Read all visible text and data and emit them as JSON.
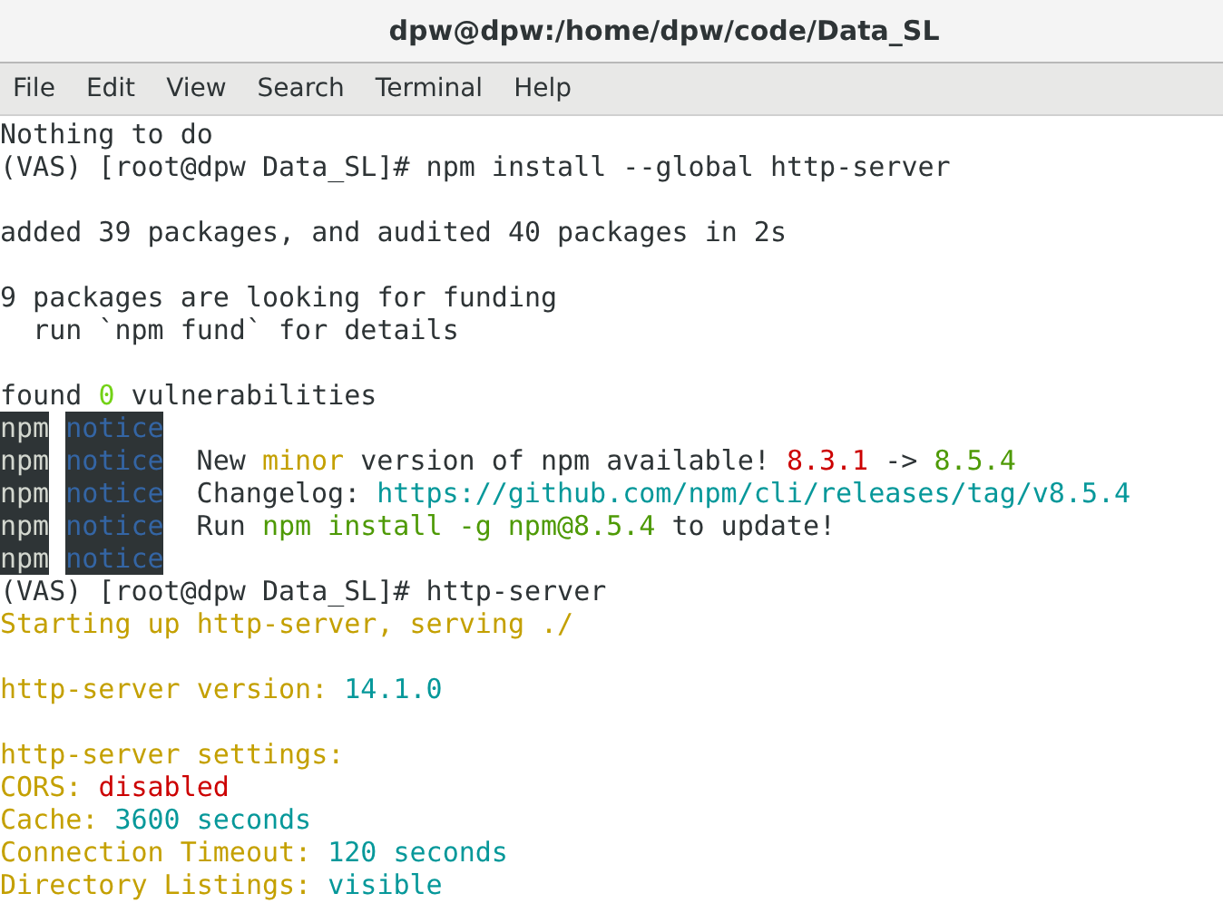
{
  "window": {
    "title": "dpw@dpw:/home/dpw/code/Data_SL"
  },
  "menu": [
    {
      "label": "File"
    },
    {
      "label": "Edit"
    },
    {
      "label": "View"
    },
    {
      "label": "Search"
    },
    {
      "label": "Terminal"
    },
    {
      "label": "Help"
    }
  ],
  "terminal": {
    "lines": [
      {
        "kind": "output",
        "segments": [
          {
            "kind": "text",
            "text": "Nothing to do",
            "color": "#2e3436"
          }
        ]
      },
      {
        "kind": "output",
        "segments": [
          {
            "kind": "text",
            "text": "(VAS) [root@dpw Data_SL]# npm install --global http-server",
            "color": "#2e3436"
          }
        ]
      },
      {
        "kind": "blank"
      },
      {
        "kind": "output",
        "segments": [
          {
            "kind": "text",
            "text": "added 39 packages, and audited 40 packages in 2s",
            "color": "#2e3436"
          }
        ]
      },
      {
        "kind": "blank"
      },
      {
        "kind": "output",
        "segments": [
          {
            "kind": "text",
            "text": "9 packages are looking for funding",
            "color": "#2e3436"
          }
        ]
      },
      {
        "kind": "output",
        "segments": [
          {
            "kind": "text",
            "text": "  run `npm fund` for details",
            "color": "#2e3436"
          }
        ]
      },
      {
        "kind": "blank"
      },
      {
        "kind": "output",
        "segments": [
          {
            "kind": "text",
            "text": "found ",
            "color": "#2e3436"
          },
          {
            "kind": "text",
            "text": "0",
            "color": "#73d216"
          },
          {
            "kind": "text",
            "text": " vulnerabilities",
            "color": "#2e3436"
          }
        ]
      },
      {
        "kind": "output",
        "segments": [
          {
            "kind": "source-tag",
            "text": "npm"
          },
          {
            "kind": "level-tag",
            "text": "notice"
          }
        ]
      },
      {
        "kind": "output",
        "segments": [
          {
            "kind": "source-tag",
            "text": "npm"
          },
          {
            "kind": "level-tag",
            "text": "notice"
          },
          {
            "kind": "text",
            "text": " New ",
            "color": "#2e3436"
          },
          {
            "kind": "text",
            "text": "minor",
            "color": "#c4a000"
          },
          {
            "kind": "text",
            "text": " version of npm available! ",
            "color": "#2e3436"
          },
          {
            "kind": "text",
            "text": "8.3.1",
            "color": "#cc0000"
          },
          {
            "kind": "text",
            "text": " -> ",
            "color": "#2e3436"
          },
          {
            "kind": "text",
            "text": "8.5.4",
            "color": "#4e9a06"
          }
        ]
      },
      {
        "kind": "output",
        "segments": [
          {
            "kind": "source-tag",
            "text": "npm"
          },
          {
            "kind": "level-tag",
            "text": "notice"
          },
          {
            "kind": "text",
            "text": " Changelog: ",
            "color": "#2e3436"
          },
          {
            "kind": "text",
            "text": "https://github.com/npm/cli/releases/tag/v8.5.4",
            "color": "#06989a"
          }
        ]
      },
      {
        "kind": "output",
        "segments": [
          {
            "kind": "source-tag",
            "text": "npm"
          },
          {
            "kind": "level-tag",
            "text": "notice"
          },
          {
            "kind": "text",
            "text": " Run ",
            "color": "#2e3436"
          },
          {
            "kind": "text",
            "text": "npm install -g npm@8.5.4",
            "color": "#4e9a06"
          },
          {
            "kind": "text",
            "text": " to update!",
            "color": "#2e3436"
          }
        ]
      },
      {
        "kind": "output",
        "segments": [
          {
            "kind": "source-tag",
            "text": "npm"
          },
          {
            "kind": "level-tag",
            "text": "notice"
          }
        ]
      },
      {
        "kind": "output",
        "segments": [
          {
            "kind": "text",
            "text": "(VAS) [root@dpw Data_SL]# http-server",
            "color": "#2e3436"
          }
        ]
      },
      {
        "kind": "output",
        "segments": [
          {
            "kind": "text",
            "text": "Starting up http-server, serving ./",
            "color": "#c4a000"
          }
        ]
      },
      {
        "kind": "blank"
      },
      {
        "kind": "output",
        "segments": [
          {
            "kind": "text",
            "text": "http-server version: ",
            "color": "#c4a000"
          },
          {
            "kind": "text",
            "text": "14.1.0",
            "color": "#06989a"
          }
        ]
      },
      {
        "kind": "blank"
      },
      {
        "kind": "output",
        "segments": [
          {
            "kind": "text",
            "text": "http-server settings:",
            "color": "#c4a000"
          }
        ]
      },
      {
        "kind": "output",
        "segments": [
          {
            "kind": "text",
            "text": "CORS: ",
            "color": "#c4a000"
          },
          {
            "kind": "text",
            "text": "disabled",
            "color": "#cc0000"
          }
        ]
      },
      {
        "kind": "output",
        "segments": [
          {
            "kind": "text",
            "text": "Cache: ",
            "color": "#c4a000"
          },
          {
            "kind": "text",
            "text": "3600 seconds",
            "color": "#06989a"
          }
        ]
      },
      {
        "kind": "output",
        "segments": [
          {
            "kind": "text",
            "text": "Connection Timeout: ",
            "color": "#c4a000"
          },
          {
            "kind": "text",
            "text": "120 seconds",
            "color": "#06989a"
          }
        ]
      },
      {
        "kind": "output",
        "segments": [
          {
            "kind": "text",
            "text": "Directory Listings: ",
            "color": "#c4a000"
          },
          {
            "kind": "text",
            "text": "visible",
            "color": "#06989a"
          }
        ]
      }
    ]
  }
}
